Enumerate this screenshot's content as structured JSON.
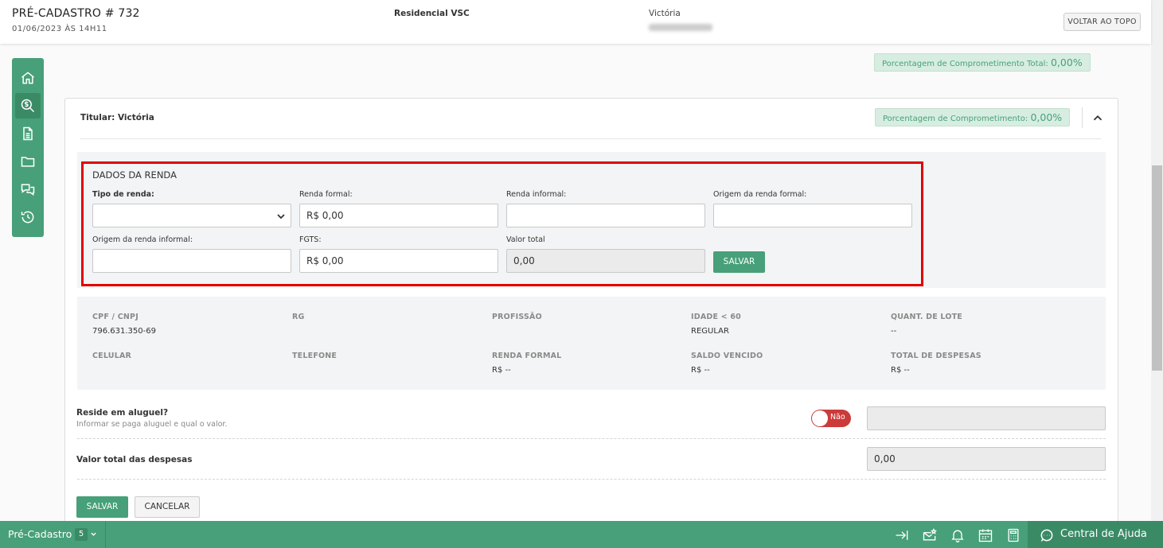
{
  "header": {
    "title": "PRÉ-CADASTRO # 732",
    "date": "01/06/2023 ÀS 14H11",
    "project": "Residencial VSC",
    "client_name": "Victória",
    "back_to_top": "VOLTAR AO TOPO"
  },
  "sidebar": {
    "items": [
      {
        "icon": "home-icon"
      },
      {
        "icon": "money-search-icon",
        "active": true
      },
      {
        "icon": "document-icon"
      },
      {
        "icon": "folder-icon"
      },
      {
        "icon": "chat-icon"
      },
      {
        "icon": "history-icon"
      }
    ]
  },
  "summary": {
    "total_label": "Porcentagem de Comprometimento Total:",
    "total_value": "0,00%"
  },
  "holder": {
    "title": "Titular: Victória",
    "percent_label": "Porcentagem de Comprometimento:",
    "percent_value": "0,00%"
  },
  "income": {
    "section_title": "DADOS DA RENDA",
    "tipo_label": "Tipo de renda:",
    "tipo_value": "",
    "formal_label": "Renda formal:",
    "formal_value": "R$ 0,00",
    "informal_label": "Renda informal:",
    "informal_value": "",
    "origem_formal_label": "Origem da renda formal:",
    "origem_formal_value": "",
    "origem_informal_label": "Origem da renda informal:",
    "origem_informal_value": "",
    "fgts_label": "FGTS:",
    "fgts_value": "R$ 0,00",
    "total_label": "Valor total",
    "total_value": "0,00",
    "save": "SALVAR"
  },
  "info": {
    "cpf_label": "CPF / CNPJ",
    "cpf_value": "796.631.350-69",
    "rg_label": "RG",
    "profissao_label": "PROFISSÃO",
    "idade_label": "IDADE < 60",
    "idade_value": "REGULAR",
    "lote_label": "QUANT. DE LOTE",
    "lote_value": "--",
    "celular_label": "CELULAR",
    "telefone_label": "TELEFONE",
    "renda_formal_label": "RENDA FORMAL",
    "renda_formal_value": "R$ --",
    "saldo_label": "SALDO VENCIDO",
    "saldo_value": "R$ --",
    "despesas_label": "TOTAL DE DESPESAS",
    "despesas_value": "R$ --"
  },
  "rent": {
    "question": "Reside em aluguel?",
    "hint": "Informar se paga aluguel e qual o valor.",
    "toggle_label": "Não",
    "toggle_on": false,
    "value": ""
  },
  "expenses": {
    "label": "Valor total das despesas",
    "value": "0,00"
  },
  "actions": {
    "save": "SALVAR",
    "cancel": "CANCELAR"
  },
  "bottombar": {
    "tab_label": "Pré-Cadastro",
    "tab_count": "5",
    "help_label": "Central de Ajuda",
    "icons": [
      "login-arrow-icon",
      "mail-star-icon",
      "bell-icon",
      "calendar-icon",
      "calculator-icon"
    ]
  },
  "colors": {
    "primary": "#47a079",
    "primary_dark": "#3a8a66",
    "highlight": "#e00000",
    "toggle_off": "#cc3a3a"
  }
}
